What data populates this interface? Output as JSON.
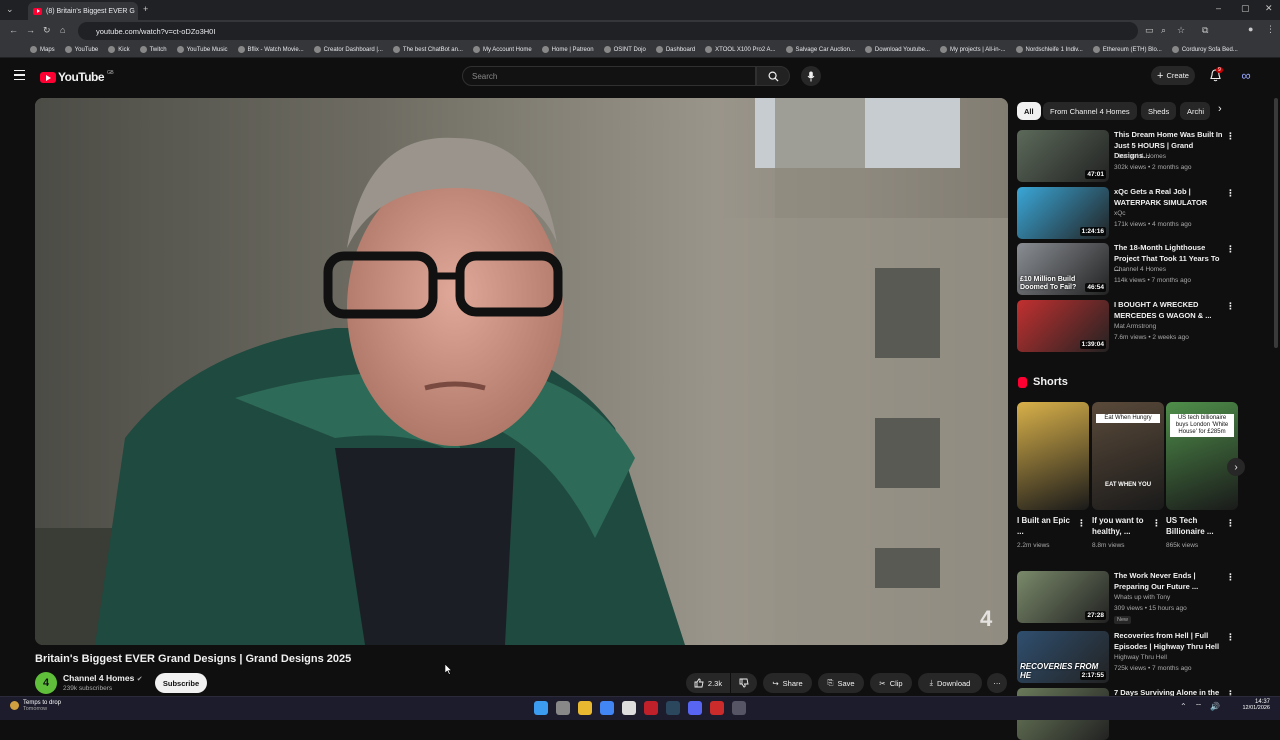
{
  "browser": {
    "tab_title": "(8) Britain's Biggest EVER G",
    "url": "youtube.com/watch?v=ct-oDZo3H0I",
    "bookmarks": [
      "Maps",
      "YouTube",
      "Kick",
      "Twitch",
      "YouTube Music",
      "Bflix - Watch Movie...",
      "Creator Dashboard |...",
      "The best ChatBot an...",
      "My Account Home",
      "Home | Patreon",
      "OSINT Dojo",
      "Dashboard",
      "XTOOL X100 Pro2 A...",
      "Salvage Car Auction...",
      "Download Youtube...",
      "My projects | All-in-...",
      "Nordschleife 1 Indiv...",
      "Ethereum (ETH) Blo...",
      "Corduroy Sofa Bed..."
    ]
  },
  "header": {
    "logo_text": "YouTube",
    "logo_country": "GB",
    "search_placeholder": "Search",
    "create_label": "Create",
    "notification_count": "9"
  },
  "video": {
    "title": "Britain's Biggest EVER Grand Designs | Grand Designs 2025",
    "channel_name": "Channel 4 Homes",
    "channel_avatar": "4",
    "subscribers": "239k subscribers",
    "subscribe_label": "Subscribe",
    "like_count": "2.3k",
    "share_label": "Share",
    "save_label": "Save",
    "clip_label": "Clip",
    "download_label": "Download",
    "watermark": "4"
  },
  "chips": [
    "All",
    "From Channel 4 Homes",
    "Sheds",
    "Archi"
  ],
  "recommendations": [
    {
      "title": "This Dream Home Was Built In Just 5 HOURS | Grand Designs...",
      "channel": "Channel 4 Homes",
      "meta": "302k views • 2 months ago",
      "duration": "47:01",
      "thumb_color": "#5c6a5a"
    },
    {
      "title": "xQc Gets a Real Job | WATERPARK SIMULATOR",
      "channel": "xQc",
      "meta": "171k views • 4 months ago",
      "duration": "1:24:16",
      "thumb_color": "#3aa7d8"
    },
    {
      "title": "The 18-Month Lighthouse Project That Took 11 Years To ...",
      "channel": "Channel 4 Homes",
      "meta": "114k views • 7 months ago",
      "duration": "46:54",
      "thumb_color": "#8a8e94",
      "thumb_text": "£10 Million Build Doomed To Fail?"
    },
    {
      "title": "I BOUGHT A WRECKED MERCEDES G WAGON & ...",
      "channel": "Mat Armstrong",
      "meta": "7.6m views • 2 weeks ago",
      "duration": "1:39:04",
      "thumb_color": "#c23030"
    }
  ],
  "shorts_heading": "Shorts",
  "shorts": [
    {
      "title": "I Built an Epic ...",
      "views": "2.2m views",
      "color": "#d9b14a"
    },
    {
      "title": "If you want to healthy, ...",
      "views": "8.8m views",
      "color": "#5a4a3a",
      "top_text": "Eat When Hungry",
      "bottom_text": "EAT WHEN YOU"
    },
    {
      "title": "US Tech Billionaire ...",
      "views": "865k views",
      "color": "#4f8f4a",
      "top_text": "US tech billionaire buys London 'White House' for £285m"
    }
  ],
  "more_recs": [
    {
      "title": "The Work Never Ends | Preparing Our Future ...",
      "channel": "Whats up with Tony",
      "meta": "309 views • 15 hours ago",
      "badge": "New",
      "duration": "27:28",
      "thumb_color": "#7a8a6a"
    },
    {
      "title": "Recoveries from Hell | Full Episodes | Highway Thru Hell",
      "channel": "Highway Thru Hell",
      "meta": "725k views • 7 months ago",
      "duration": "2:17:55",
      "thumb_color": "#2f4f6f",
      "thumb_text": "RECOVERIES FROM HE"
    },
    {
      "title": "7 Days Surviving Alone in the",
      "thumb_color": "#6a7a5a"
    }
  ],
  "taskbar": {
    "weather_title": "Temps to drop",
    "weather_sub": "Tomorrow",
    "time": "14:37",
    "date": "12/01/2026"
  },
  "colors": {
    "accent": "#ff0033",
    "background": "#0f0f0f",
    "chip": "#272727"
  }
}
